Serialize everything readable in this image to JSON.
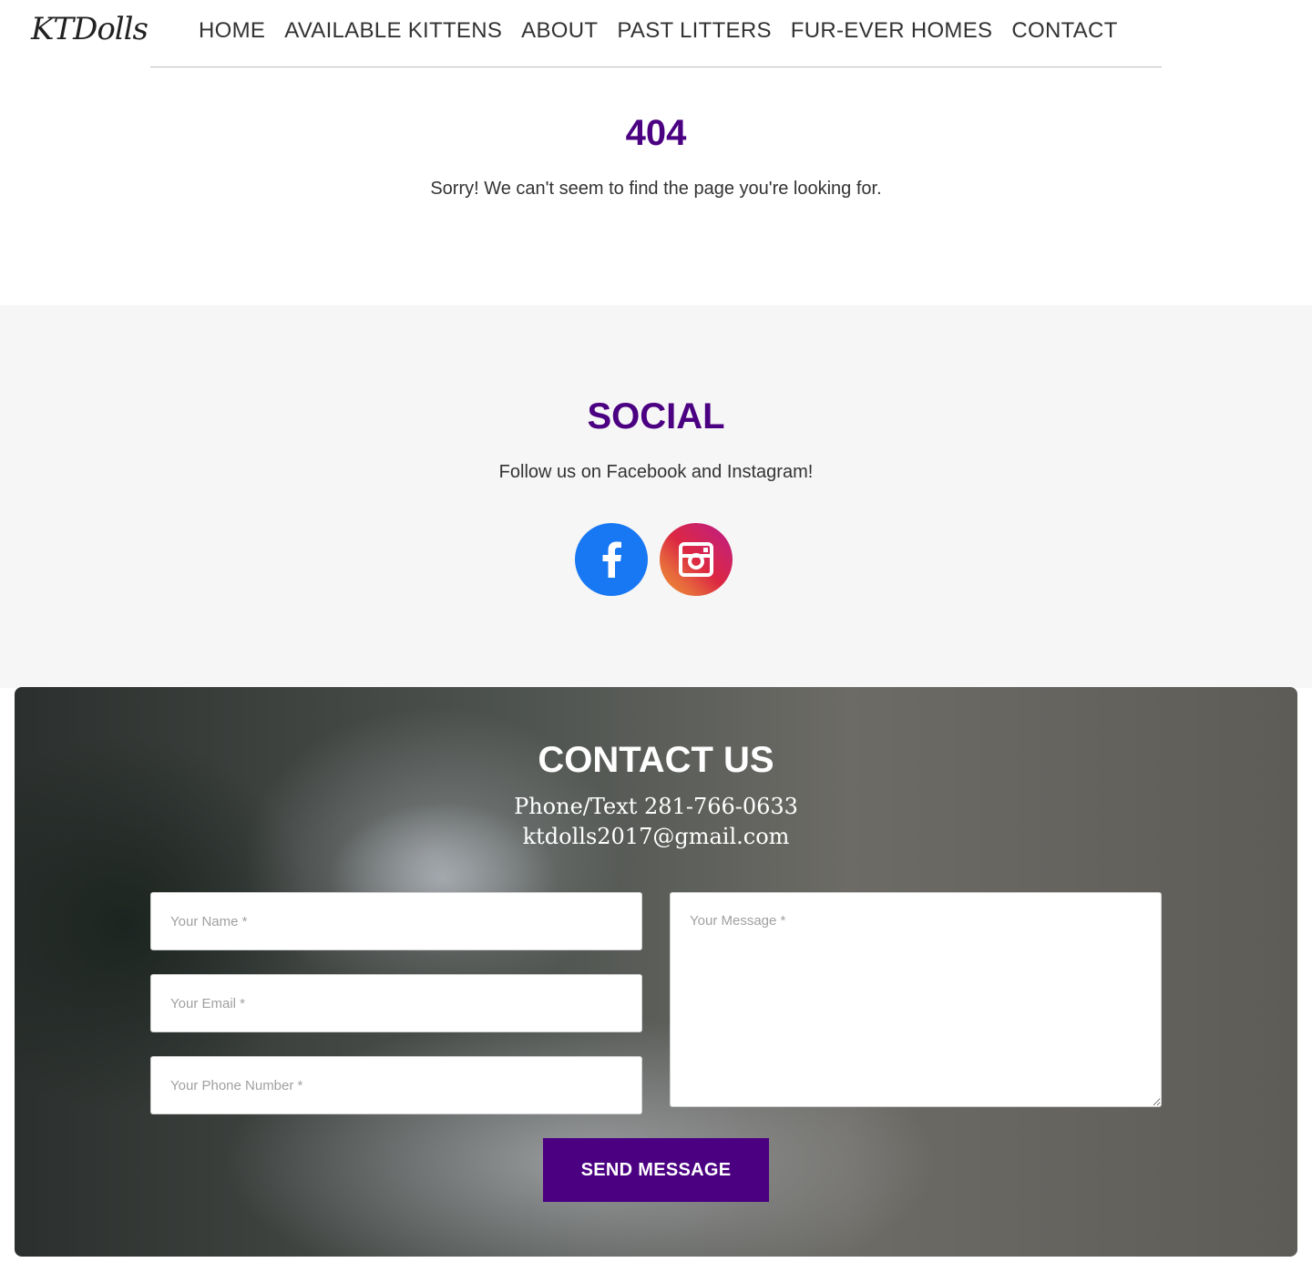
{
  "header": {
    "logo": "KTDolls",
    "nav": [
      "HOME",
      "AVAILABLE KITTENS",
      "ABOUT",
      "PAST LITTERS",
      "FUR-EVER HOMES",
      "CONTACT"
    ]
  },
  "error": {
    "code": "404",
    "message": "Sorry! We can't seem to find the page you're looking for."
  },
  "social": {
    "title": "SOCIAL",
    "text": "Follow us on Facebook and Instagram!",
    "icons": [
      "facebook-icon",
      "instagram-icon"
    ]
  },
  "contact": {
    "title": "CONTACT US",
    "phone": "Phone/Text 281-766-0633",
    "email": "ktdolls2017@gmail.com",
    "form": {
      "name_placeholder": "Your Name *",
      "email_placeholder": "Your Email *",
      "phone_placeholder": "Your Phone Number *",
      "message_placeholder": "Your Message *",
      "submit_label": "SEND MESSAGE"
    }
  },
  "colors": {
    "accent": "#4b0082",
    "facebook": "#1877f2",
    "social_bg": "#f6f6f6"
  }
}
